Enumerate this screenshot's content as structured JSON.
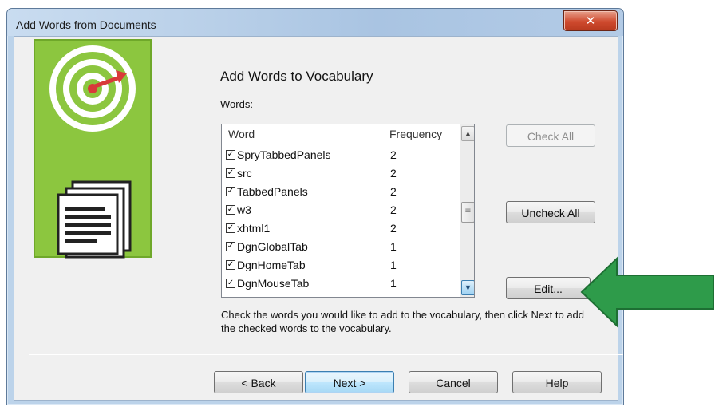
{
  "window": {
    "title": "Add Words from Documents",
    "close_icon": "close-icon"
  },
  "page": {
    "heading": "Add Words to Vocabulary",
    "words_label_u": "W",
    "words_label_rest": "ords:"
  },
  "list": {
    "columns": [
      "Word",
      "Frequency"
    ],
    "rows": [
      {
        "word": "SpryTabbedPanels",
        "frequency": "2",
        "checked": true
      },
      {
        "word": "src",
        "frequency": "2",
        "checked": true
      },
      {
        "word": "TabbedPanels",
        "frequency": "2",
        "checked": true
      },
      {
        "word": "w3",
        "frequency": "2",
        "checked": true
      },
      {
        "word": "xhtml1",
        "frequency": "2",
        "checked": true
      },
      {
        "word": "DgnGlobalTab",
        "frequency": "1",
        "checked": true
      },
      {
        "word": "DgnHomeTab",
        "frequency": "1",
        "checked": true
      },
      {
        "word": "DgnMouseTab",
        "frequency": "1",
        "checked": true
      }
    ],
    "partial_row_frequency": "1"
  },
  "buttons": {
    "check_all": "Check All",
    "uncheck_all": "Uncheck All",
    "edit": "Edit...",
    "back": "< Back",
    "next": "Next >",
    "cancel": "Cancel",
    "help": "Help"
  },
  "description": "Check the words you would like to add to the vocabulary, then click Next to add the checked words to the vocabulary.",
  "colors": {
    "illustration_green": "#8cc63f",
    "arrow_green": "#2e9b4a",
    "target_red": "#d93a3a"
  }
}
